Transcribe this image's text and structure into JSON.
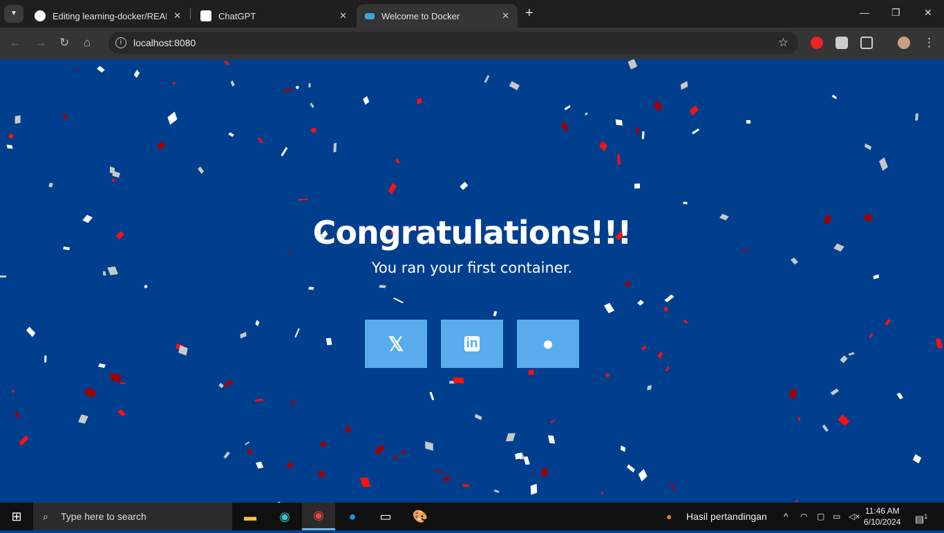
{
  "browser": {
    "tabs": [
      {
        "title": "Editing learning-docker/README.md",
        "icon": "github-icon"
      },
      {
        "title": "ChatGPT",
        "icon": "chatgpt-icon"
      },
      {
        "title": "Welcome to Docker",
        "icon": "docker-icon",
        "active": true
      }
    ],
    "url": "localhost:8080"
  },
  "page": {
    "heading": "Congratulations!!!",
    "subheading": "You ran your first container.",
    "share": [
      {
        "name": "x",
        "glyph": "𝕏"
      },
      {
        "name": "linkedin",
        "glyph": "in"
      },
      {
        "name": "reddit",
        "glyph": "●"
      }
    ],
    "colors": {
      "background": "#003f8e",
      "button": "#58acec"
    }
  },
  "taskbar": {
    "search_placeholder": "Type here to search",
    "news": "Hasil pertandingan",
    "time": "11:46 AM",
    "date": "6/10/2024",
    "notifications": "1"
  }
}
